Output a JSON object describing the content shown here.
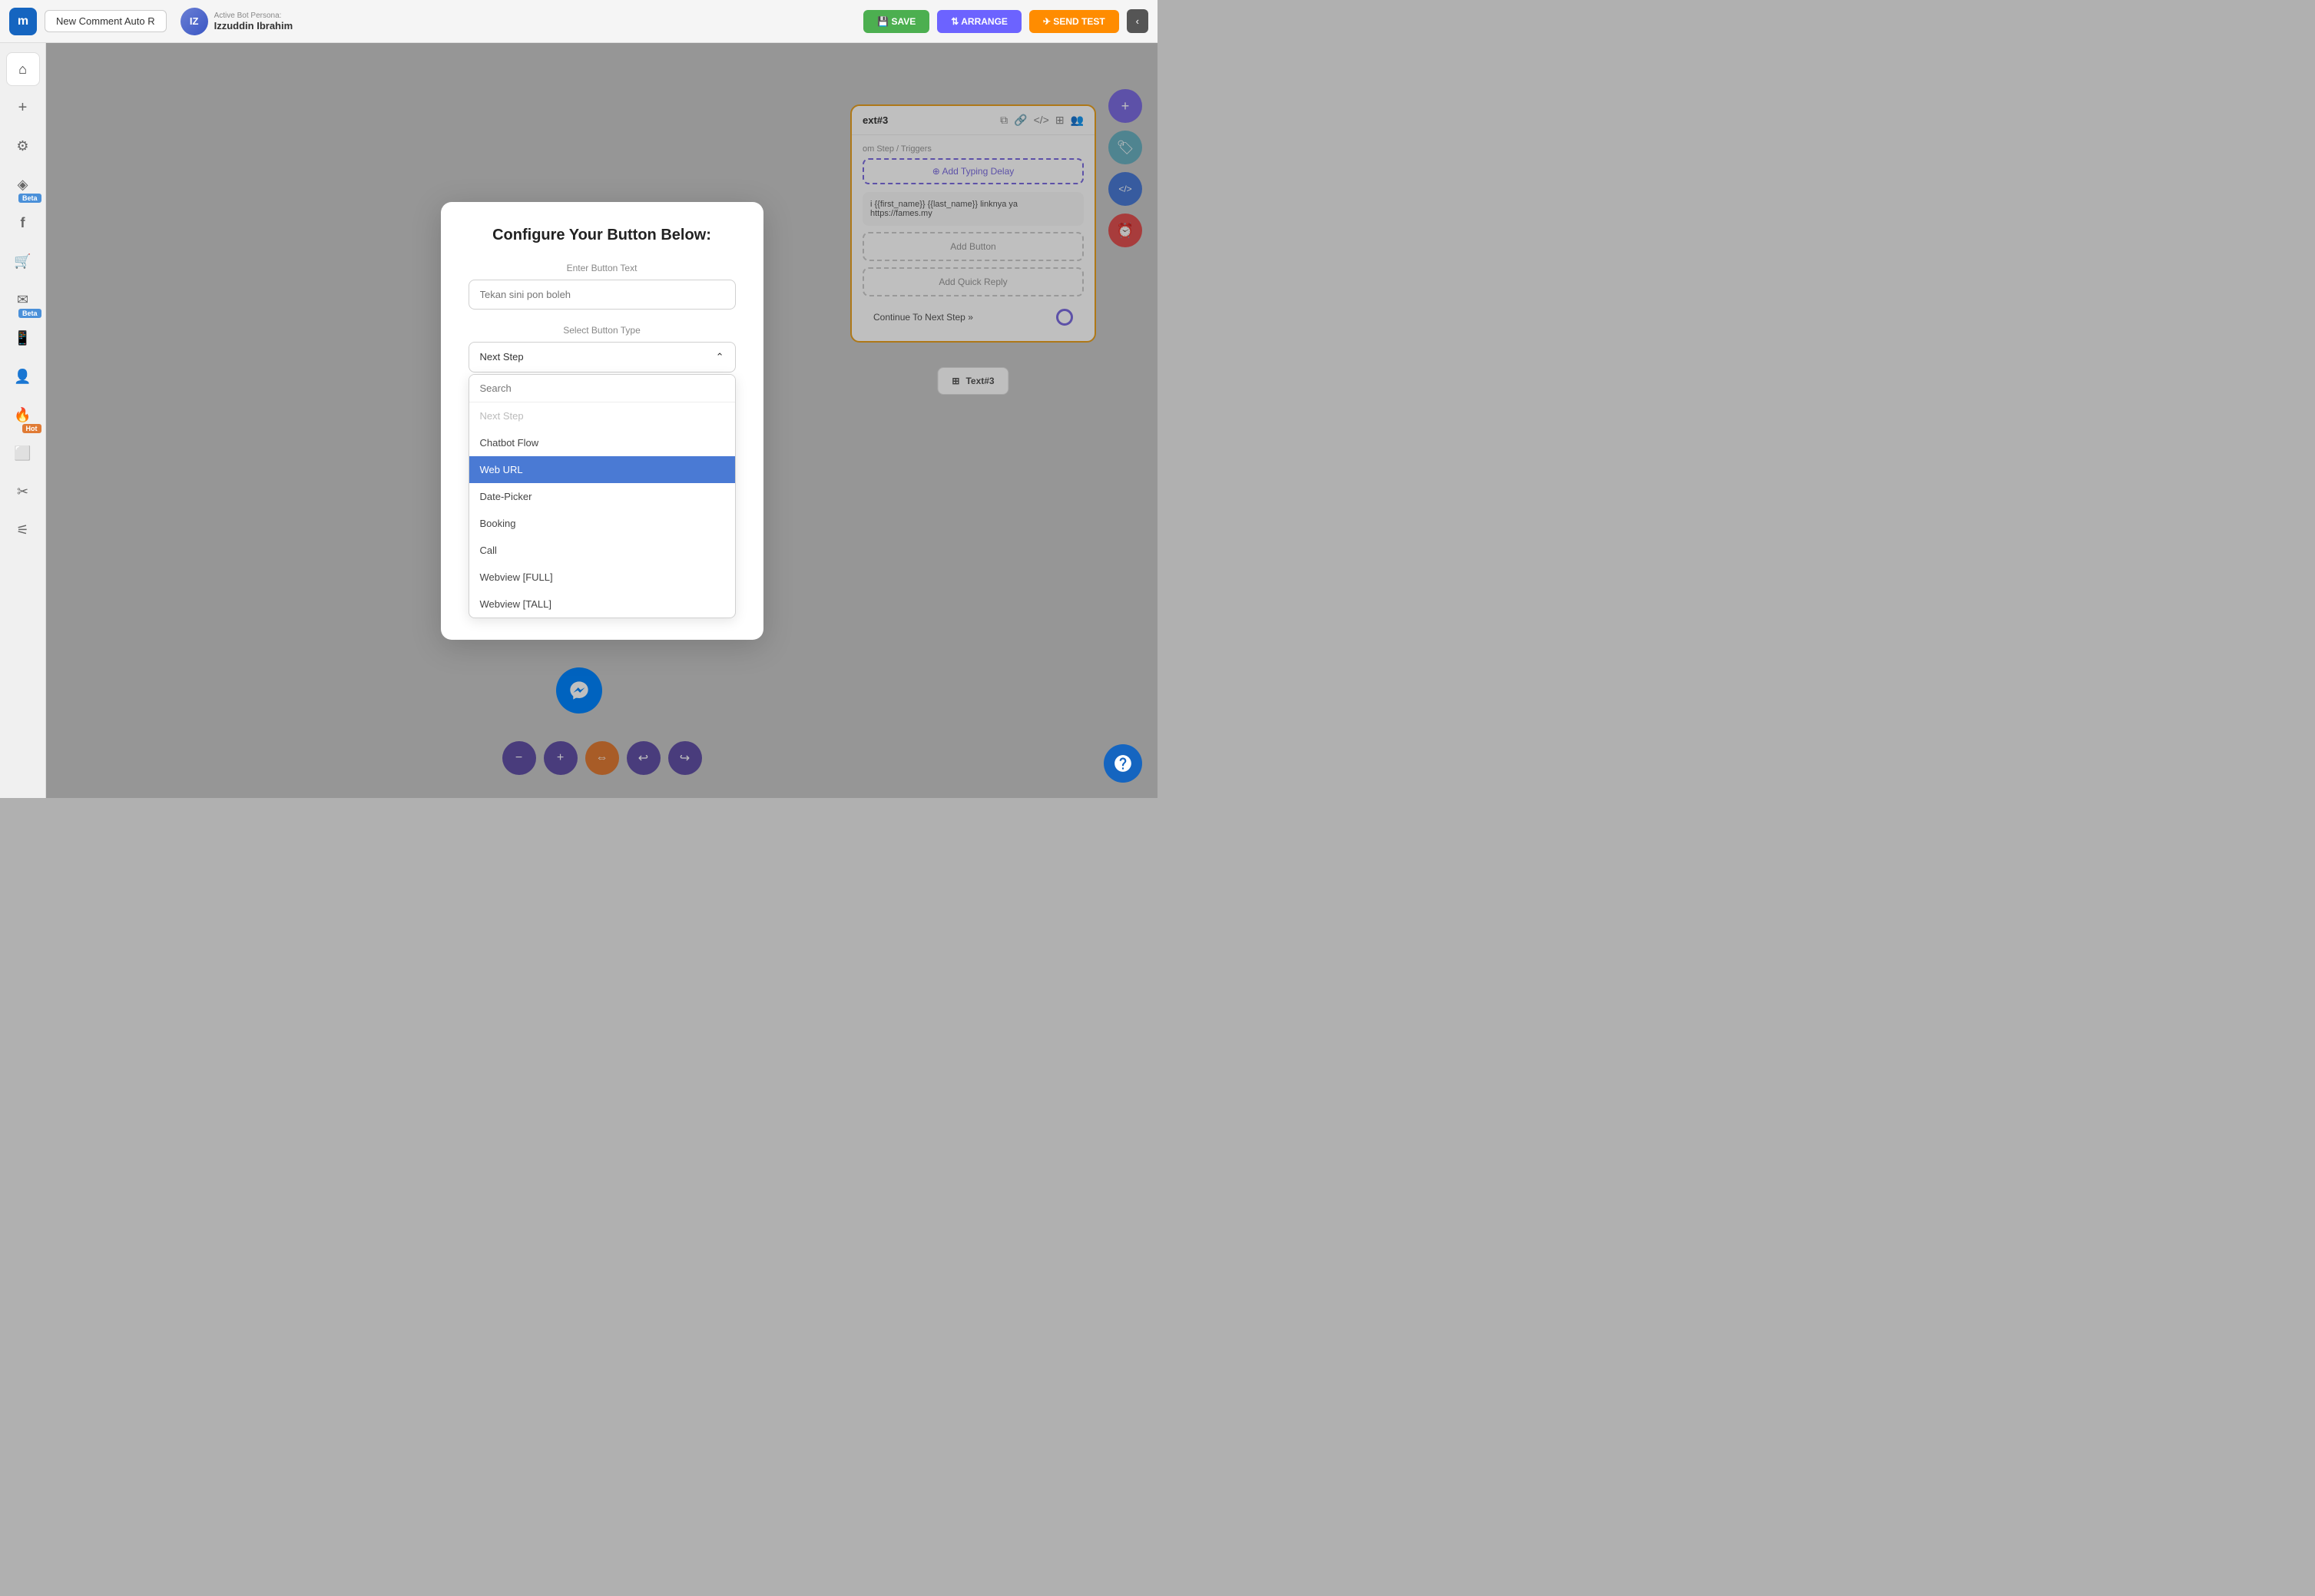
{
  "topbar": {
    "logo": "m",
    "flow_name": "New Comment Auto R",
    "persona_label": "Active Bot Persona:",
    "persona_name": "Izzuddin Ibrahim",
    "btn_save": "💾 SAVE",
    "btn_arrange": "⇅ ARRANGE",
    "btn_send_test": "✈ SEND TEST",
    "btn_chevron": "‹"
  },
  "sidebar": {
    "items": [
      {
        "icon": "⌂",
        "label": "home",
        "active": true,
        "badge": ""
      },
      {
        "icon": "＋",
        "label": "add",
        "active": false,
        "badge": ""
      },
      {
        "icon": "⚙",
        "label": "settings",
        "active": false,
        "badge": ""
      },
      {
        "icon": "ƒ",
        "label": "beta",
        "active": false,
        "badge": "Beta"
      },
      {
        "icon": "f",
        "label": "facebook",
        "active": false,
        "badge": ""
      },
      {
        "icon": "🛒",
        "label": "cart",
        "active": false,
        "badge": ""
      },
      {
        "icon": "✉",
        "label": "beta2",
        "active": false,
        "badge": "Beta"
      },
      {
        "icon": "📱",
        "label": "mobile",
        "active": false,
        "badge": ""
      },
      {
        "icon": "👤",
        "label": "user",
        "active": false,
        "badge": ""
      },
      {
        "icon": "🔥",
        "label": "hot",
        "active": false,
        "badge": "Hot"
      },
      {
        "icon": "⬜",
        "label": "box",
        "active": false,
        "badge": ""
      },
      {
        "icon": "✂",
        "label": "tools",
        "active": false,
        "badge": ""
      },
      {
        "icon": "⚟",
        "label": "network",
        "active": false,
        "badge": ""
      }
    ]
  },
  "right_panel": {
    "add_btn": "+",
    "tag_btn": "🏷",
    "code_btn": "</>",
    "clock_btn": "⏰"
  },
  "node_card": {
    "title": "ext#3",
    "label": "om Step / Triggers",
    "typing_delay": "Add Typing Delay",
    "text_content": "i {{first_name}} {{last_name}} linknya ya https://fames.my",
    "add_button": "Add Button",
    "quick_reply": "Add Quick Reply",
    "continue_text": "Continue To Next Step »"
  },
  "below_node": {
    "icon": "⊞",
    "title": "Text#3"
  },
  "modal": {
    "title": "Configure Your Button Below:",
    "enter_text_label": "Enter Button Text",
    "input_placeholder": "Tekan sini pon boleh",
    "input_value": "",
    "select_label": "Select Button Type",
    "selected_value": "Next Step",
    "chevron_up": "^",
    "dropdown_search_placeholder": "Search",
    "dropdown_items": [
      {
        "label": "Next Step",
        "disabled": true,
        "selected": false
      },
      {
        "label": "Chatbot Flow",
        "disabled": false,
        "selected": false
      },
      {
        "label": "Web URL",
        "disabled": false,
        "selected": true
      },
      {
        "label": "Date-Picker",
        "disabled": false,
        "selected": false
      },
      {
        "label": "Booking",
        "disabled": false,
        "selected": false
      },
      {
        "label": "Call",
        "disabled": false,
        "selected": false
      },
      {
        "label": "Webview [FULL]",
        "disabled": false,
        "selected": false
      },
      {
        "label": "Webview [TALL]",
        "disabled": false,
        "selected": false
      }
    ]
  },
  "bottom_toolbar": {
    "zoom_out": "−",
    "zoom_in": "+",
    "center": "⇔",
    "undo": "↩",
    "redo": "↪"
  }
}
